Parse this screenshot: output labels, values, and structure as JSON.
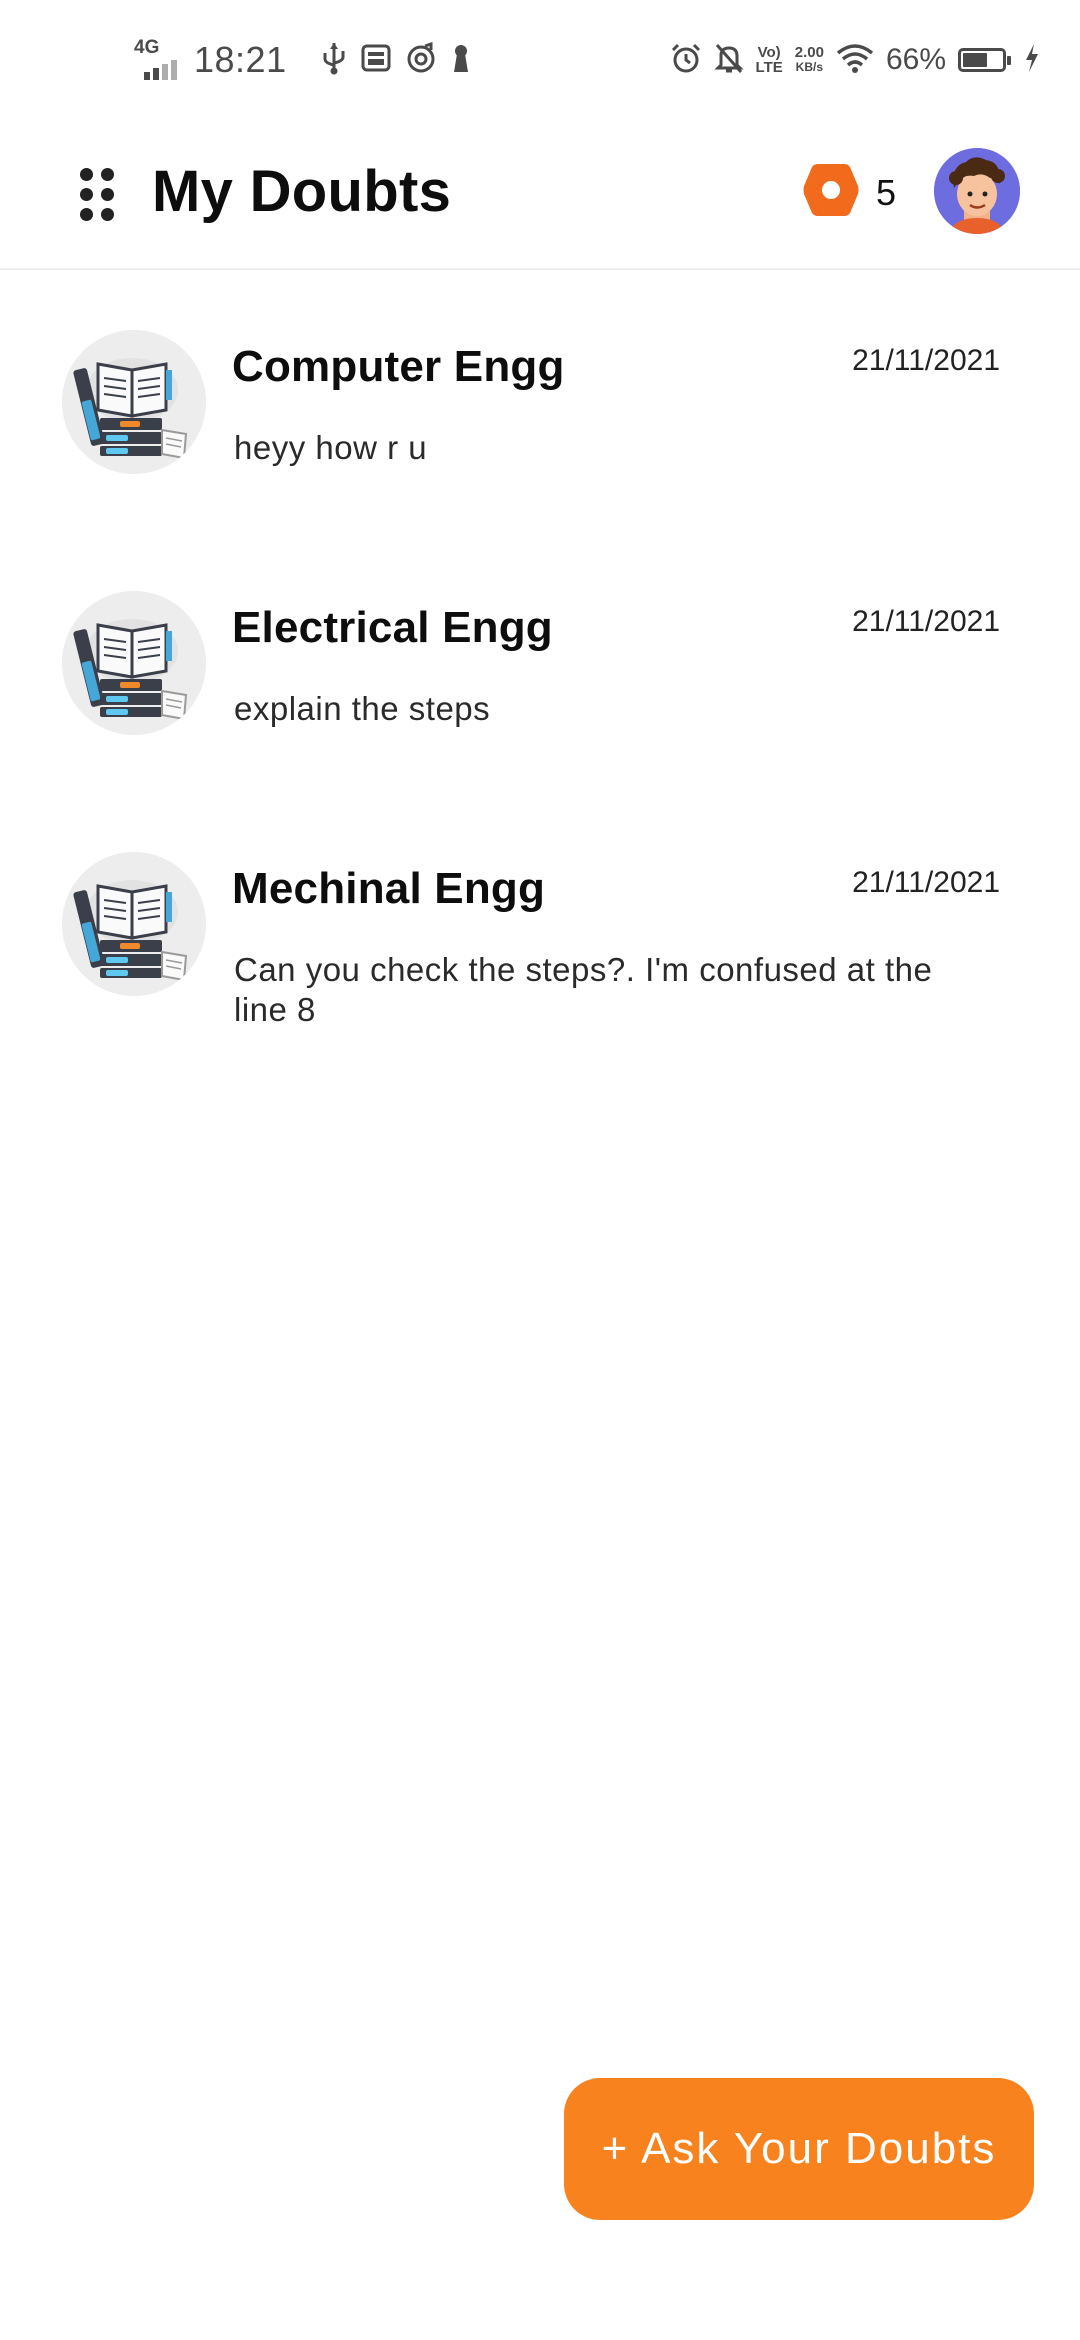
{
  "status_bar": {
    "network_type": "4G",
    "time": "18:21",
    "volte_top": "Vo)",
    "volte_bottom": "LTE",
    "speed_value": "2.00",
    "speed_unit": "KB/s",
    "battery_percent": "66%",
    "battery_level": 0.66,
    "icons": [
      "signal-icon",
      "usb-icon",
      "message-icon",
      "music-icon",
      "keyhole-icon",
      "alarm-icon",
      "bell-off-icon",
      "wifi-icon",
      "battery-icon",
      "charging-icon"
    ]
  },
  "header": {
    "title": "My Doubts",
    "coin_count": "5",
    "menu_icon": "grid-dots-icon",
    "coin_icon": "coin-icon",
    "avatar_icon": "user-avatar"
  },
  "doubts": [
    {
      "subject": "Computer Engg",
      "date": "21/11/2021",
      "message": "heyy how r u"
    },
    {
      "subject": "Electrical Engg",
      "date": "21/11/2021",
      "message": "explain the steps"
    },
    {
      "subject": "Mechinal Engg",
      "date": "21/11/2021",
      "message": "Can you check the steps?. I'm confused at the line 8"
    }
  ],
  "fab": {
    "label": "+ Ask Your Doubts"
  },
  "colors": {
    "accent": "#f8821e",
    "coin": "#f26a1b",
    "avatar_bg": "#6d6de0",
    "text_primary": "#0d0d0d",
    "text_secondary": "#2a2a2a",
    "status_icons": "#4a4a4a"
  }
}
